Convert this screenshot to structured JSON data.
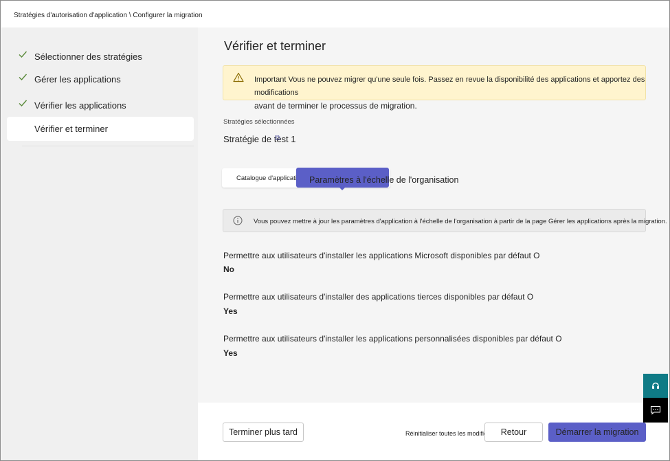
{
  "breadcrumb": "Stratégies d'autorisation d'application \\ Configurer la migration",
  "steps": [
    {
      "label": "Sélectionner des stratégies",
      "state": "done"
    },
    {
      "label": "Gérer les applications",
      "state": "done"
    },
    {
      "label": "Vérifier les applications",
      "state": "done"
    },
    {
      "label": "Vérifier et terminer",
      "state": "active"
    }
  ],
  "main": {
    "title": "Vérifier et terminer",
    "warning": {
      "line1": "Important Vous ne pouvez migrer qu'une seule fois. Passez en revue la disponibilité des applications et apportez des modifications",
      "line2": "avant de terminer le processus de migration."
    },
    "selected_policies_label": "Stratégies sélectionnées",
    "policy_name": "Stratégie de test 1",
    "tabs": {
      "catalog": "Catalogue d'applications",
      "org_settings": "Paramètres à l'échelle de l'organisation"
    },
    "info_text": "Vous pouvez mettre à jour les paramètres d'application à l'échelle de l'organisation à partir de la page Gérer les applications après la migration.",
    "settings": [
      {
        "question": "Permettre aux utilisateurs d'installer les applications Microsoft disponibles par défaut O",
        "answer": "No"
      },
      {
        "question": "Permettre aux utilisateurs d'installer des applications tierces disponibles par défaut O",
        "answer": "Yes"
      },
      {
        "question": "Permettre aux utilisateurs d'installer les applications personnalisées disponibles par défaut O",
        "answer": "Yes"
      }
    ]
  },
  "footer": {
    "finish_later": "Terminer plus tard",
    "reset": "Réinitialiser toutes les modifications",
    "back": "Retour",
    "start": "Démarrer la migration"
  },
  "icons": {
    "check": "checkmark-icon",
    "warning": "warning-triangle-icon",
    "info": "info-circle-icon",
    "help": "headset-help-icon",
    "feedback": "chat-feedback-icon"
  },
  "colors": {
    "accent": "#5b5fc7",
    "warning_bg": "#fff4ce",
    "help_bg": "#0f7b86",
    "check": "#5a8a3a"
  }
}
